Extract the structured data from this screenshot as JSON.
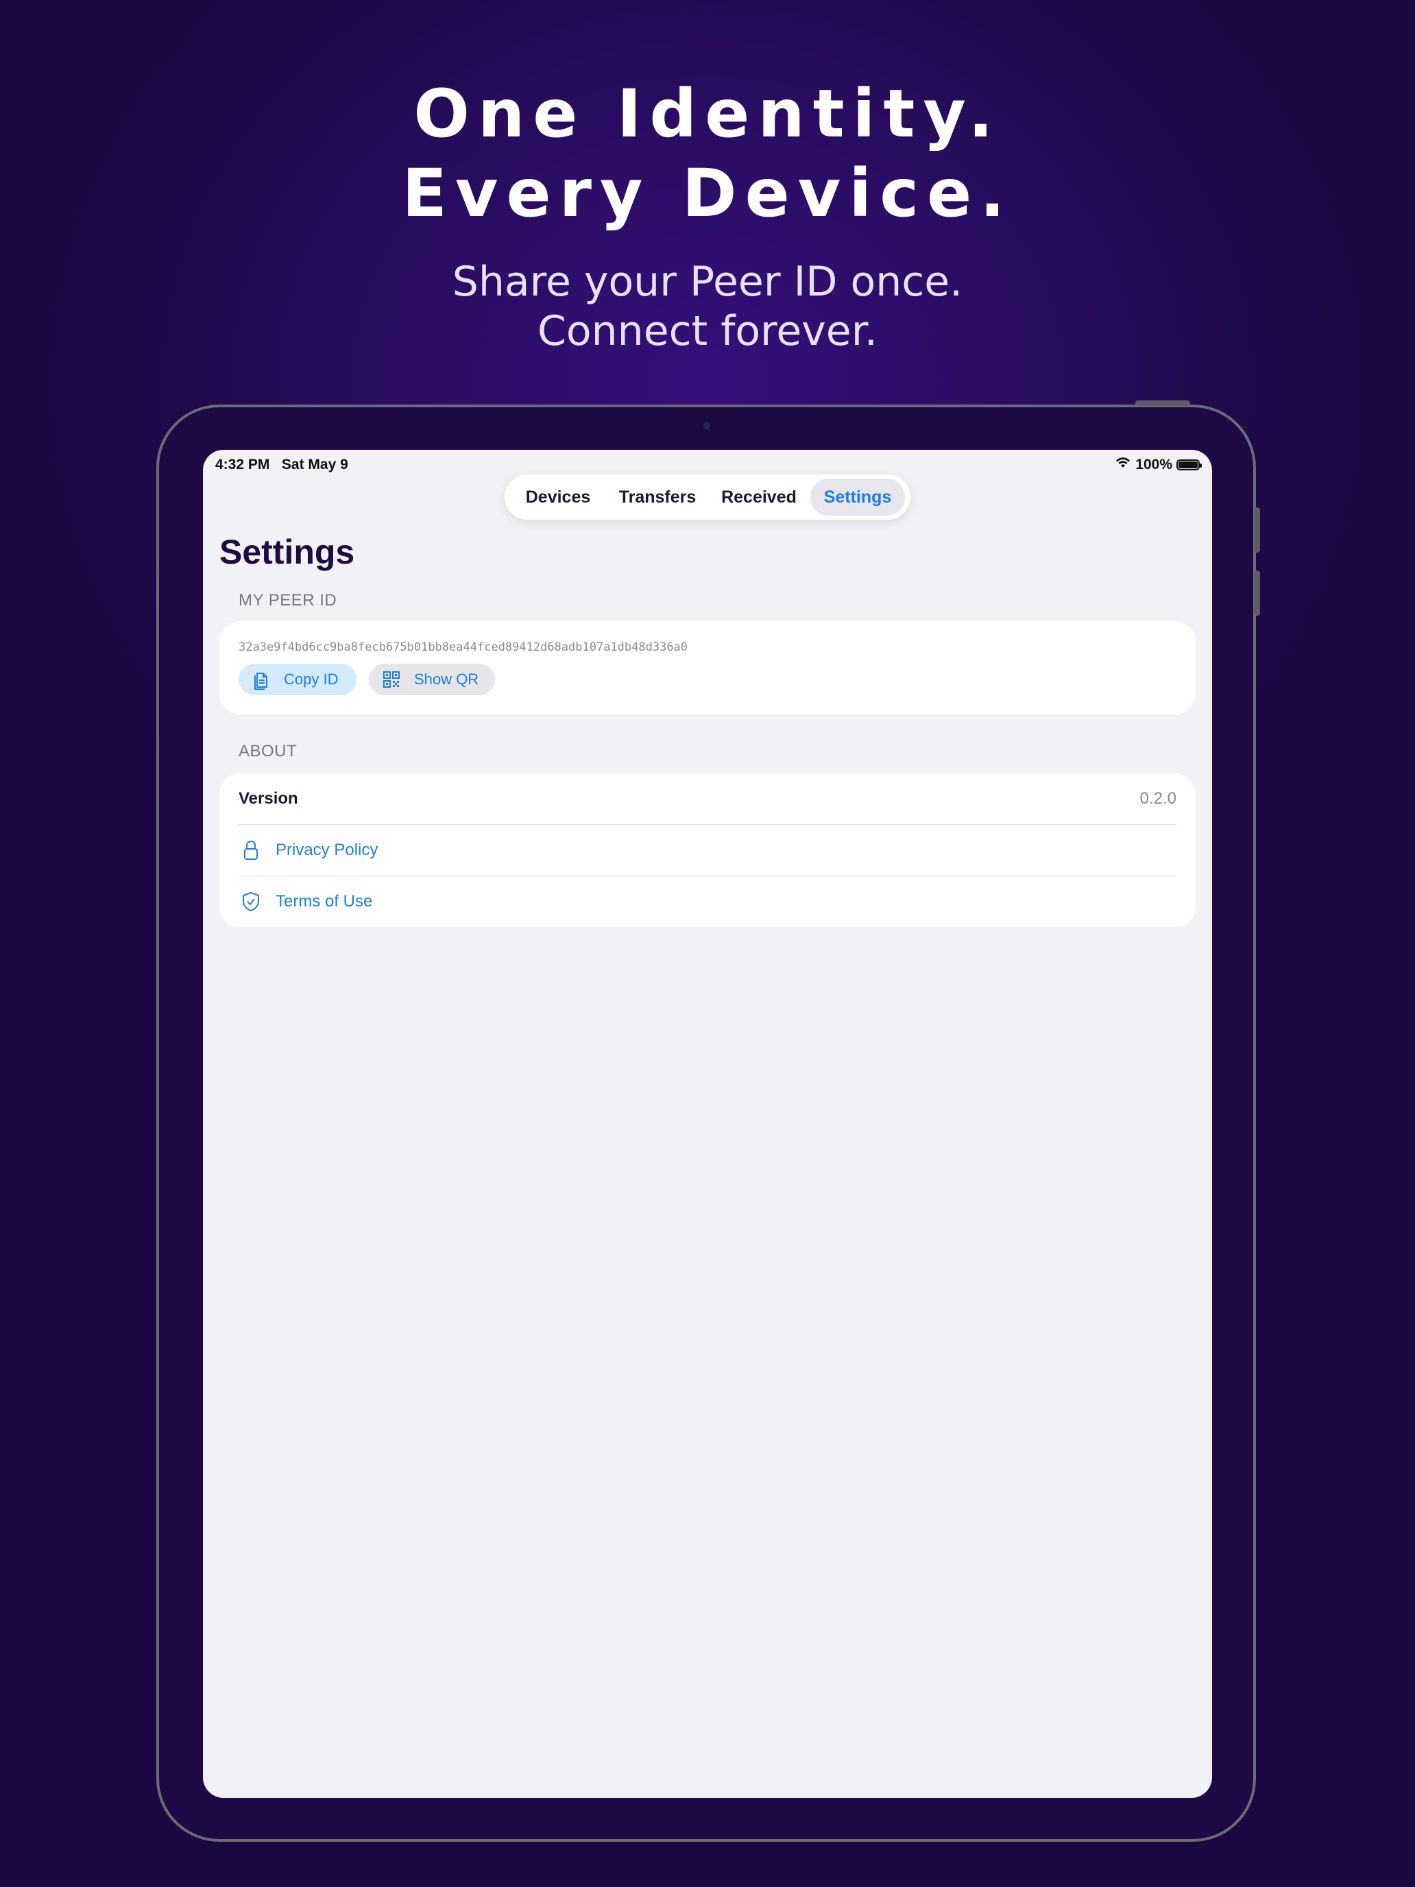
{
  "headline": {
    "line1": "One Identity.",
    "line2": "Every Device."
  },
  "subline": {
    "line1": "Share your Peer ID once.",
    "line2": "Connect forever."
  },
  "status_bar": {
    "time": "4:32 PM",
    "date": "Sat May 9",
    "battery": "100%",
    "wifi_icon": "wifi-icon"
  },
  "tabs": [
    {
      "label": "Devices",
      "active": false
    },
    {
      "label": "Transfers",
      "active": false
    },
    {
      "label": "Received",
      "active": false
    },
    {
      "label": "Settings",
      "active": true
    }
  ],
  "page": {
    "title": "Settings"
  },
  "peer_section": {
    "header": "MY PEER ID",
    "peer_id": "32a3e9f4bd6cc9ba8fecb675b01bb8ea44fced89412d68adb107a1db48d336a0",
    "copy_label": "Copy ID",
    "copy_icon": "copy-icon",
    "qr_label": "Show QR",
    "qr_icon": "qr-code-icon"
  },
  "about_section": {
    "header": "ABOUT",
    "version_label": "Version",
    "version_value": "0.2.0",
    "privacy_label": "Privacy Policy",
    "privacy_icon": "lock-icon",
    "terms_label": "Terms of Use",
    "terms_icon": "checkmark-shield-icon"
  },
  "colors": {
    "background": "#2a0d63",
    "accent": "#1a7fdc",
    "title": "#1e0c40",
    "screen": "#f2f2f6"
  }
}
